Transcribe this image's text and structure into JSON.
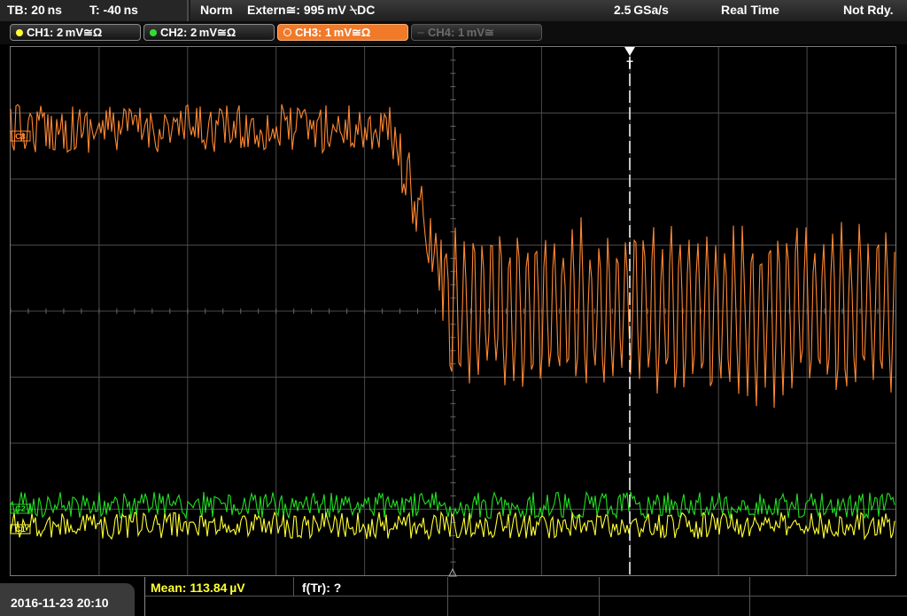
{
  "status_bar": {
    "timebase": "TB: 20 ns",
    "trigger_time": "T: -40 ns",
    "trigger_mode": "Norm",
    "trigger_source": "Extern≅: 995 mV ⍀DC",
    "sample_rate": "2.5 GSa/s",
    "acq_mode": "Real Time",
    "status": "Not Rdy."
  },
  "channels": [
    {
      "label": "CH1: 2 mV≅Ω",
      "color": "#ffff33",
      "state": "on"
    },
    {
      "label": "CH2: 2 mV≅Ω",
      "color": "#33dd33",
      "state": "on"
    },
    {
      "label": "CH3: 1 mV≅Ω",
      "color": "#ff8c3a",
      "state": "selected"
    },
    {
      "label": "CH4: 1 mV≅",
      "color": "#666666",
      "state": "off"
    }
  ],
  "markers": {
    "ch3_marker": "C3",
    "ch2_marker": "C2",
    "ch1_marker": "C1",
    "trigger_marker": "T"
  },
  "bottom": {
    "datetime": "2016-11-23 20:10",
    "mean": "Mean: 113.84 µV",
    "rise_freq": "f(Tr): ?"
  },
  "colors": {
    "ch1": "#ffff33",
    "ch2": "#22dd22",
    "ch3": "#ff8833",
    "grid": "#4a4a4a",
    "cursor": "#ffffff"
  }
}
